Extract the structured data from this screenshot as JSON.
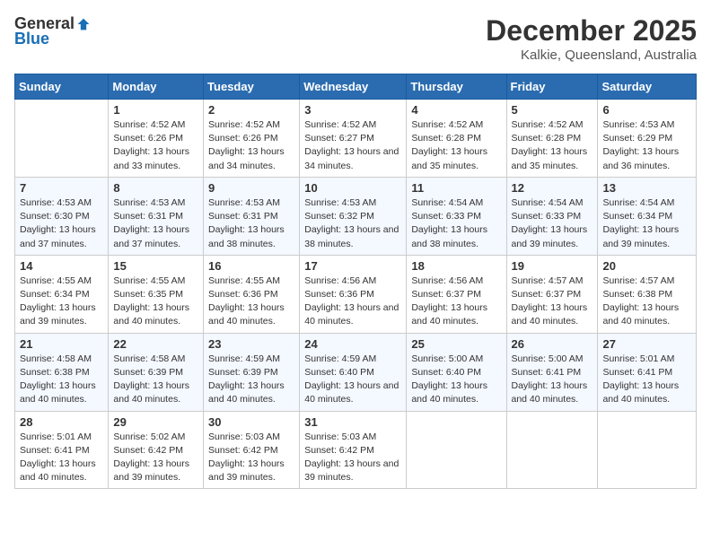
{
  "header": {
    "logo_general": "General",
    "logo_blue": "Blue",
    "month_title": "December 2025",
    "location": "Kalkie, Queensland, Australia"
  },
  "days_of_week": [
    "Sunday",
    "Monday",
    "Tuesday",
    "Wednesday",
    "Thursday",
    "Friday",
    "Saturday"
  ],
  "weeks": [
    [
      {
        "day": "",
        "sunrise": "",
        "sunset": "",
        "daylight": ""
      },
      {
        "day": "1",
        "sunrise": "Sunrise: 4:52 AM",
        "sunset": "Sunset: 6:26 PM",
        "daylight": "Daylight: 13 hours and 33 minutes."
      },
      {
        "day": "2",
        "sunrise": "Sunrise: 4:52 AM",
        "sunset": "Sunset: 6:26 PM",
        "daylight": "Daylight: 13 hours and 34 minutes."
      },
      {
        "day": "3",
        "sunrise": "Sunrise: 4:52 AM",
        "sunset": "Sunset: 6:27 PM",
        "daylight": "Daylight: 13 hours and 34 minutes."
      },
      {
        "day": "4",
        "sunrise": "Sunrise: 4:52 AM",
        "sunset": "Sunset: 6:28 PM",
        "daylight": "Daylight: 13 hours and 35 minutes."
      },
      {
        "day": "5",
        "sunrise": "Sunrise: 4:52 AM",
        "sunset": "Sunset: 6:28 PM",
        "daylight": "Daylight: 13 hours and 35 minutes."
      },
      {
        "day": "6",
        "sunrise": "Sunrise: 4:53 AM",
        "sunset": "Sunset: 6:29 PM",
        "daylight": "Daylight: 13 hours and 36 minutes."
      }
    ],
    [
      {
        "day": "7",
        "sunrise": "Sunrise: 4:53 AM",
        "sunset": "Sunset: 6:30 PM",
        "daylight": "Daylight: 13 hours and 37 minutes."
      },
      {
        "day": "8",
        "sunrise": "Sunrise: 4:53 AM",
        "sunset": "Sunset: 6:31 PM",
        "daylight": "Daylight: 13 hours and 37 minutes."
      },
      {
        "day": "9",
        "sunrise": "Sunrise: 4:53 AM",
        "sunset": "Sunset: 6:31 PM",
        "daylight": "Daylight: 13 hours and 38 minutes."
      },
      {
        "day": "10",
        "sunrise": "Sunrise: 4:53 AM",
        "sunset": "Sunset: 6:32 PM",
        "daylight": "Daylight: 13 hours and 38 minutes."
      },
      {
        "day": "11",
        "sunrise": "Sunrise: 4:54 AM",
        "sunset": "Sunset: 6:33 PM",
        "daylight": "Daylight: 13 hours and 38 minutes."
      },
      {
        "day": "12",
        "sunrise": "Sunrise: 4:54 AM",
        "sunset": "Sunset: 6:33 PM",
        "daylight": "Daylight: 13 hours and 39 minutes."
      },
      {
        "day": "13",
        "sunrise": "Sunrise: 4:54 AM",
        "sunset": "Sunset: 6:34 PM",
        "daylight": "Daylight: 13 hours and 39 minutes."
      }
    ],
    [
      {
        "day": "14",
        "sunrise": "Sunrise: 4:55 AM",
        "sunset": "Sunset: 6:34 PM",
        "daylight": "Daylight: 13 hours and 39 minutes."
      },
      {
        "day": "15",
        "sunrise": "Sunrise: 4:55 AM",
        "sunset": "Sunset: 6:35 PM",
        "daylight": "Daylight: 13 hours and 40 minutes."
      },
      {
        "day": "16",
        "sunrise": "Sunrise: 4:55 AM",
        "sunset": "Sunset: 6:36 PM",
        "daylight": "Daylight: 13 hours and 40 minutes."
      },
      {
        "day": "17",
        "sunrise": "Sunrise: 4:56 AM",
        "sunset": "Sunset: 6:36 PM",
        "daylight": "Daylight: 13 hours and 40 minutes."
      },
      {
        "day": "18",
        "sunrise": "Sunrise: 4:56 AM",
        "sunset": "Sunset: 6:37 PM",
        "daylight": "Daylight: 13 hours and 40 minutes."
      },
      {
        "day": "19",
        "sunrise": "Sunrise: 4:57 AM",
        "sunset": "Sunset: 6:37 PM",
        "daylight": "Daylight: 13 hours and 40 minutes."
      },
      {
        "day": "20",
        "sunrise": "Sunrise: 4:57 AM",
        "sunset": "Sunset: 6:38 PM",
        "daylight": "Daylight: 13 hours and 40 minutes."
      }
    ],
    [
      {
        "day": "21",
        "sunrise": "Sunrise: 4:58 AM",
        "sunset": "Sunset: 6:38 PM",
        "daylight": "Daylight: 13 hours and 40 minutes."
      },
      {
        "day": "22",
        "sunrise": "Sunrise: 4:58 AM",
        "sunset": "Sunset: 6:39 PM",
        "daylight": "Daylight: 13 hours and 40 minutes."
      },
      {
        "day": "23",
        "sunrise": "Sunrise: 4:59 AM",
        "sunset": "Sunset: 6:39 PM",
        "daylight": "Daylight: 13 hours and 40 minutes."
      },
      {
        "day": "24",
        "sunrise": "Sunrise: 4:59 AM",
        "sunset": "Sunset: 6:40 PM",
        "daylight": "Daylight: 13 hours and 40 minutes."
      },
      {
        "day": "25",
        "sunrise": "Sunrise: 5:00 AM",
        "sunset": "Sunset: 6:40 PM",
        "daylight": "Daylight: 13 hours and 40 minutes."
      },
      {
        "day": "26",
        "sunrise": "Sunrise: 5:00 AM",
        "sunset": "Sunset: 6:41 PM",
        "daylight": "Daylight: 13 hours and 40 minutes."
      },
      {
        "day": "27",
        "sunrise": "Sunrise: 5:01 AM",
        "sunset": "Sunset: 6:41 PM",
        "daylight": "Daylight: 13 hours and 40 minutes."
      }
    ],
    [
      {
        "day": "28",
        "sunrise": "Sunrise: 5:01 AM",
        "sunset": "Sunset: 6:41 PM",
        "daylight": "Daylight: 13 hours and 40 minutes."
      },
      {
        "day": "29",
        "sunrise": "Sunrise: 5:02 AM",
        "sunset": "Sunset: 6:42 PM",
        "daylight": "Daylight: 13 hours and 39 minutes."
      },
      {
        "day": "30",
        "sunrise": "Sunrise: 5:03 AM",
        "sunset": "Sunset: 6:42 PM",
        "daylight": "Daylight: 13 hours and 39 minutes."
      },
      {
        "day": "31",
        "sunrise": "Sunrise: 5:03 AM",
        "sunset": "Sunset: 6:42 PM",
        "daylight": "Daylight: 13 hours and 39 minutes."
      },
      {
        "day": "",
        "sunrise": "",
        "sunset": "",
        "daylight": ""
      },
      {
        "day": "",
        "sunrise": "",
        "sunset": "",
        "daylight": ""
      },
      {
        "day": "",
        "sunrise": "",
        "sunset": "",
        "daylight": ""
      }
    ]
  ]
}
